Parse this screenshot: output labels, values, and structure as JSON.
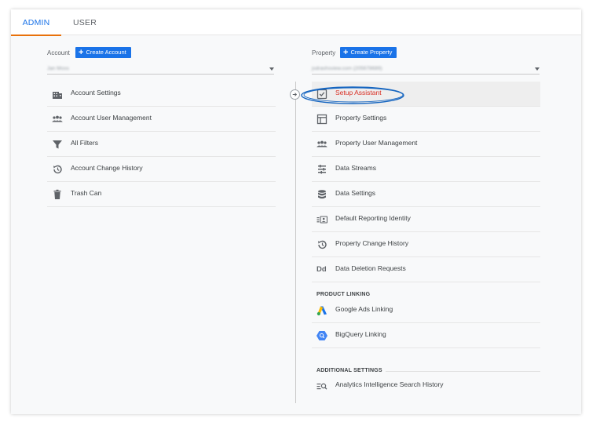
{
  "tabs": [
    {
      "label": "ADMIN"
    },
    {
      "label": "USER"
    }
  ],
  "account": {
    "label": "Account",
    "create_label": "Create Account",
    "selected": "Jan Moss",
    "menu": [
      {
        "label": "Account Settings",
        "icon": "building-icon"
      },
      {
        "label": "Account User Management",
        "icon": "people-icon"
      },
      {
        "label": "All Filters",
        "icon": "filter-icon"
      },
      {
        "label": "Account Change History",
        "icon": "history-icon"
      },
      {
        "label": "Trash Can",
        "icon": "trash-icon"
      }
    ]
  },
  "property": {
    "label": "Property",
    "create_label": "Create Property",
    "selected": "jsdrashsview.com (205678689)",
    "menu": [
      {
        "label": "Setup Assistant",
        "icon": "checklist-icon"
      },
      {
        "label": "Property Settings",
        "icon": "layout-icon"
      },
      {
        "label": "Property User Management",
        "icon": "people-icon"
      },
      {
        "label": "Data Streams",
        "icon": "streams-icon"
      },
      {
        "label": "Data Settings",
        "icon": "database-icon"
      },
      {
        "label": "Default Reporting Identity",
        "icon": "identity-icon"
      },
      {
        "label": "Property Change History",
        "icon": "history-icon"
      },
      {
        "label": "Data Deletion Requests",
        "icon": "dd-icon"
      }
    ],
    "product_linking": {
      "label": "PRODUCT LINKING",
      "items": [
        {
          "label": "Google Ads Linking",
          "icon": "google-ads-icon"
        },
        {
          "label": "BigQuery Linking",
          "icon": "bigquery-icon"
        }
      ]
    },
    "additional_settings": {
      "label": "ADDITIONAL SETTINGS",
      "items": [
        {
          "label": "Analytics Intelligence Search History",
          "icon": "search-history-icon"
        }
      ]
    }
  },
  "dd_glyph": "Dd",
  "colors": {
    "accent_blue": "#1a73e8",
    "tab_underline": "#e8710a",
    "active_red": "#d93025",
    "highlight_ring": "#1565c0"
  }
}
